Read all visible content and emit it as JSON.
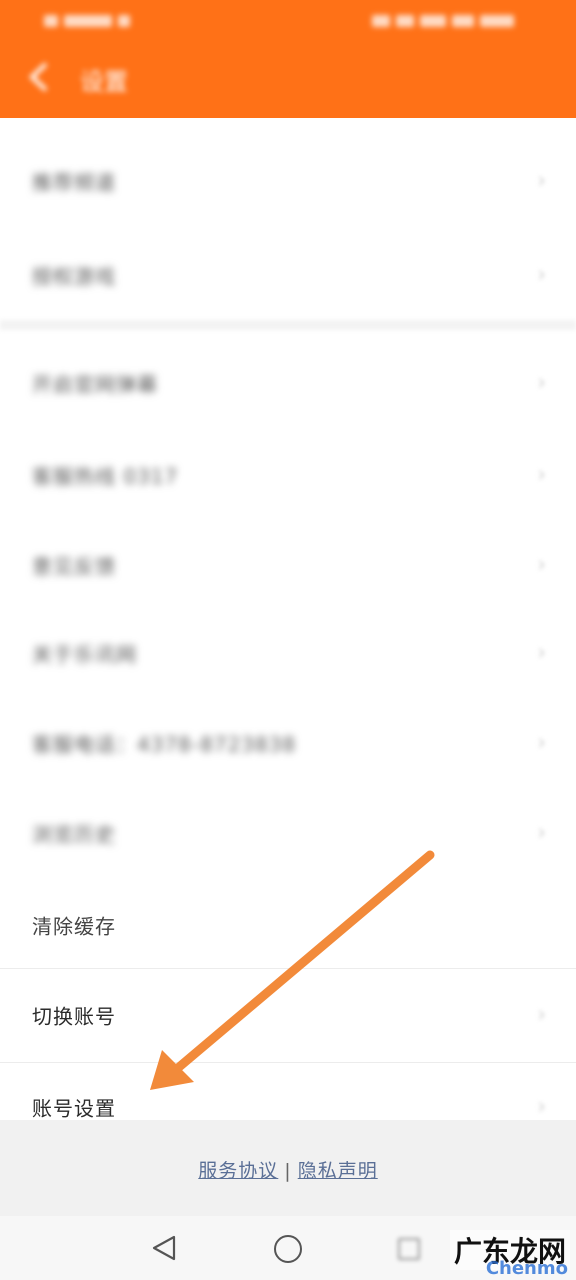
{
  "header": {
    "title": "设置",
    "back_icon": "back-arrow-icon"
  },
  "settings": {
    "items": [
      {
        "label": "推荐频道",
        "blurred": true
      },
      {
        "label": "授权游戏",
        "blurred": true
      },
      {
        "label": "开启官网弹幕",
        "blurred": true
      },
      {
        "label": "客服热线 0317",
        "blurred": true
      },
      {
        "label": "意见反馈",
        "blurred": true
      },
      {
        "label": "关于乐讯网",
        "blurred": true
      },
      {
        "label": "客服电话：4378-8723838",
        "blurred": true
      },
      {
        "label": "浏览历史",
        "blurred": true
      },
      {
        "label": "清除缓存",
        "blurred": false
      },
      {
        "label": "切换账号",
        "blurred": false
      },
      {
        "label": "账号设置",
        "blurred": false
      }
    ]
  },
  "footer": {
    "service_agreement": "服务协议",
    "separator": "|",
    "privacy_statement": "隐私声明"
  },
  "navbar": {
    "back": "nav-back-icon",
    "home": "nav-home-icon",
    "recent": "nav-recent-icon"
  },
  "watermark": {
    "text": "广东龙网",
    "sub": "Chenmo"
  },
  "colors": {
    "brand": "#ff7117",
    "arrow": "#f28a3a",
    "link": "#5a6f96"
  }
}
